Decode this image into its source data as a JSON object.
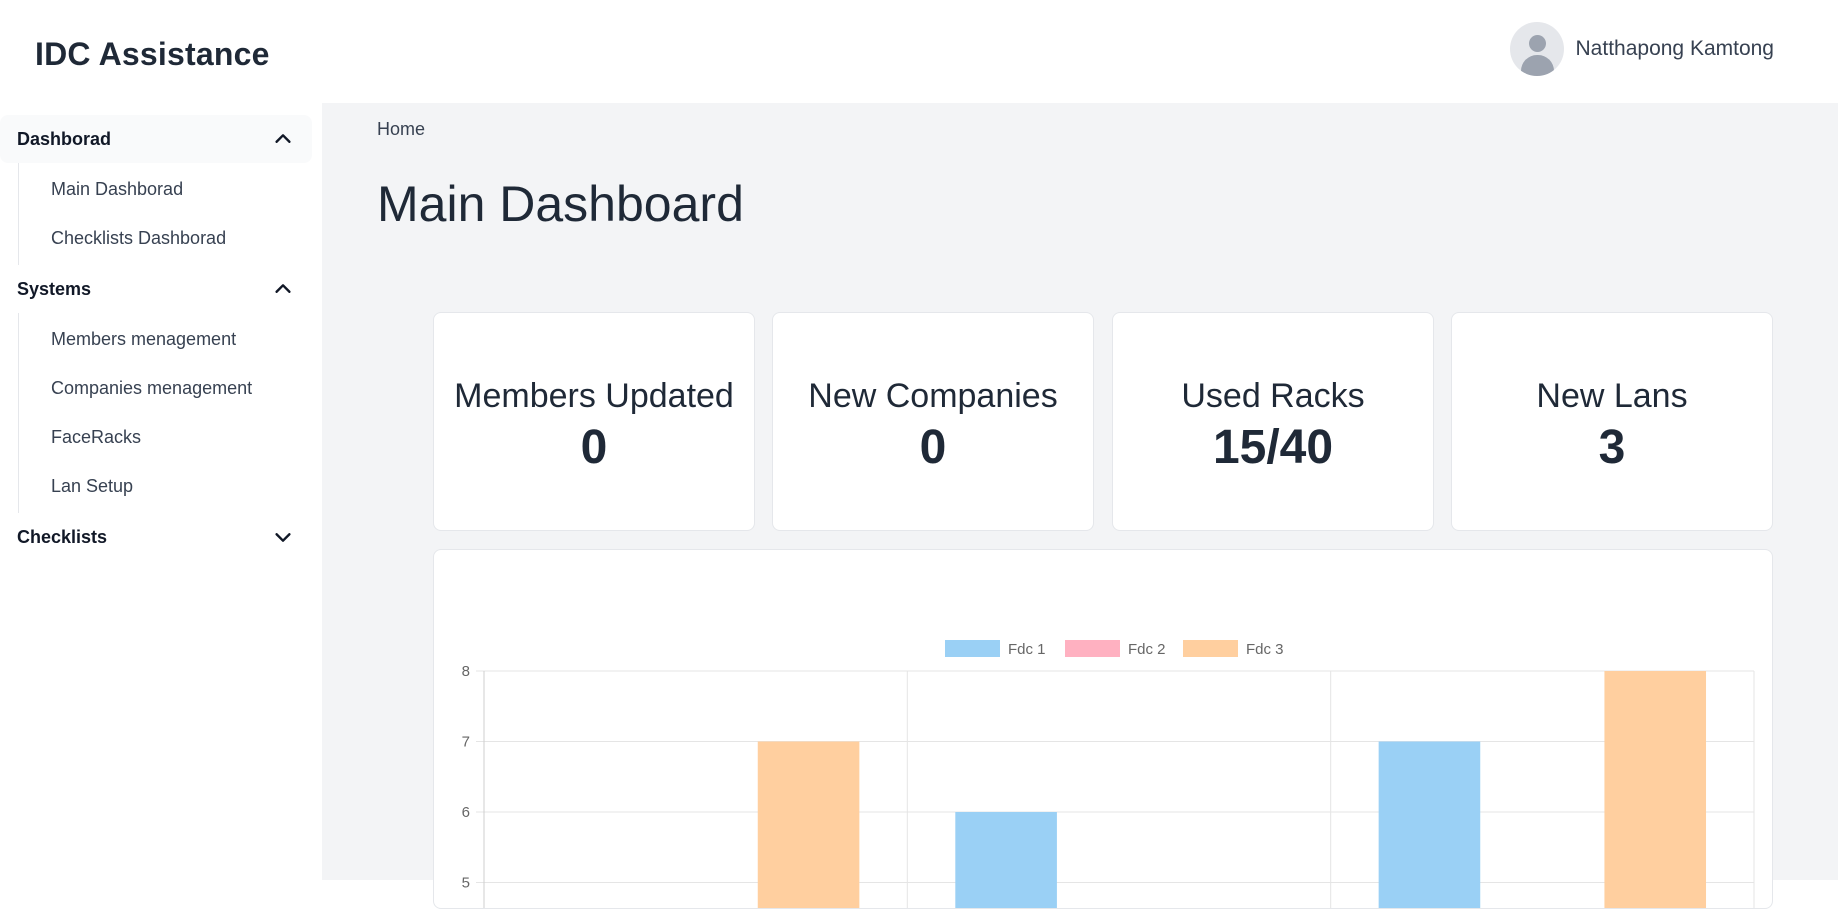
{
  "app": {
    "title": "IDC Assistance"
  },
  "user": {
    "name": "Natthapong Kamtong"
  },
  "sidebar": {
    "groups": [
      {
        "title": "Dashborad",
        "expanded": true,
        "items": [
          {
            "label": "Main Dashborad"
          },
          {
            "label": "Checklists Dashborad"
          }
        ]
      },
      {
        "title": "Systems",
        "expanded": true,
        "items": [
          {
            "label": "Members menagement"
          },
          {
            "label": "Companies menagement"
          },
          {
            "label": "FaceRacks"
          },
          {
            "label": "Lan Setup"
          }
        ]
      },
      {
        "title": "Checklists",
        "expanded": false,
        "items": []
      }
    ]
  },
  "breadcrumb": {
    "home": "Home"
  },
  "page": {
    "title": "Main Dashboard"
  },
  "stats": [
    {
      "label": "Members Updated",
      "value": "0"
    },
    {
      "label": "New Companies",
      "value": "0"
    },
    {
      "label": "Used Racks",
      "value": "15/40"
    },
    {
      "label": "New Lans",
      "value": "3"
    }
  ],
  "chart_data": {
    "type": "bar",
    "categories": [
      "",
      "",
      ""
    ],
    "series": [
      {
        "name": "Fdc 1",
        "color": "#9ad0f5",
        "values": [
          null,
          6,
          7
        ]
      },
      {
        "name": "Fdc 2",
        "color": "#ffb1c1",
        "values": [
          null,
          null,
          null
        ]
      },
      {
        "name": "Fdc 3",
        "color": "#ffcf9f",
        "values": [
          7,
          null,
          8
        ]
      }
    ],
    "y_ticks_visible": [
      "8",
      "7",
      "6",
      "5"
    ],
    "ylim_visible": [
      5,
      8
    ],
    "legend": "top-center",
    "grid": true
  }
}
